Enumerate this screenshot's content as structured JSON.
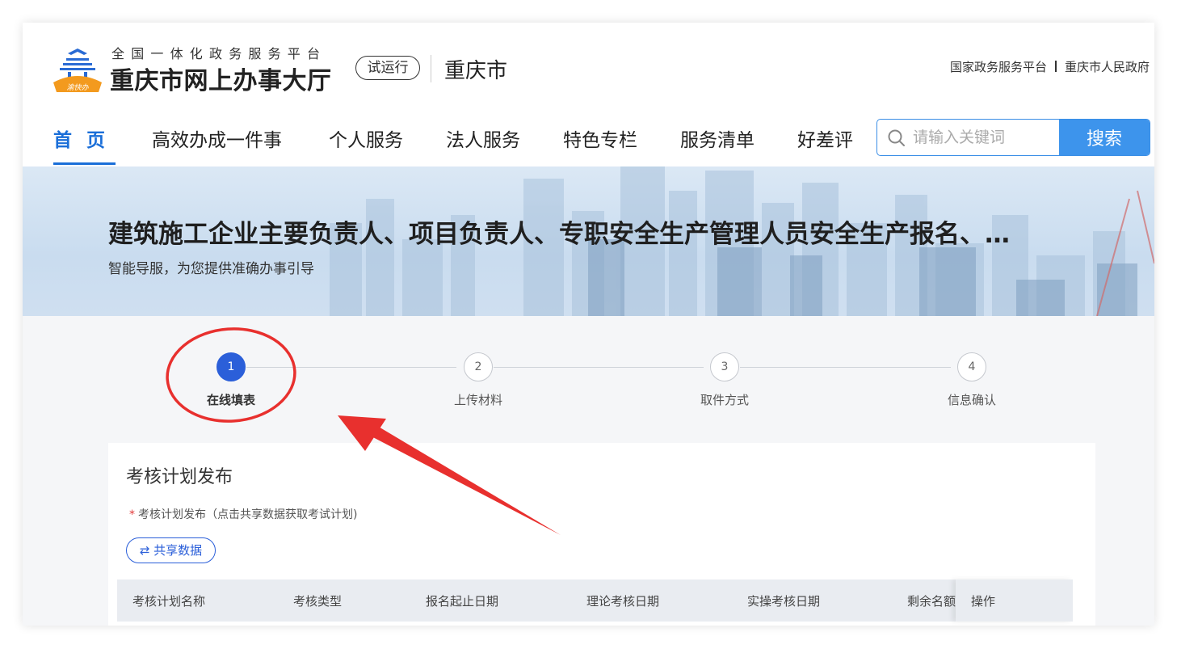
{
  "header": {
    "brand_sub": "全国一体化政务服务平台",
    "brand_main": "重庆市网上办事大厅",
    "logo_text": "渝快办",
    "trial_badge": "试运行",
    "city": "重庆市",
    "top_links": [
      "国家政务服务平台",
      "重庆市人民政府"
    ]
  },
  "nav": {
    "items": [
      "首页",
      "高效办成一件事",
      "个人服务",
      "法人服务",
      "特色专栏",
      "服务清单",
      "好差评"
    ],
    "active": "首页"
  },
  "search": {
    "placeholder": "请输入关键词",
    "button_label": "搜索"
  },
  "banner": {
    "title": "建筑施工企业主要负责人、项目负责人、专职安全生产管理人员安全生产报名、…",
    "subtitle": "智能导服，为您提供准确办事引导"
  },
  "steps": [
    {
      "number": "1",
      "label": "在线填表",
      "active": true
    },
    {
      "number": "2",
      "label": "上传材料",
      "active": false
    },
    {
      "number": "3",
      "label": "取件方式",
      "active": false
    },
    {
      "number": "4",
      "label": "信息确认",
      "active": false
    }
  ],
  "form": {
    "section_title": "考核计划发布",
    "required_mark": "*",
    "field_label": "考核计划发布（点击共享数据获取考试计划)",
    "share_button": "⇄ 共享数据",
    "table_headers": [
      "考核计划名称",
      "考核类型",
      "报名起止日期",
      "理论考核日期",
      "实操考核日期",
      "剩余名额",
      "操作"
    ]
  },
  "colors": {
    "primary": "#1a6ed8",
    "step_active": "#2b5fd9",
    "search_button": "#3d94ec",
    "annotation": "#e8302e",
    "required": "#e23b3b"
  }
}
